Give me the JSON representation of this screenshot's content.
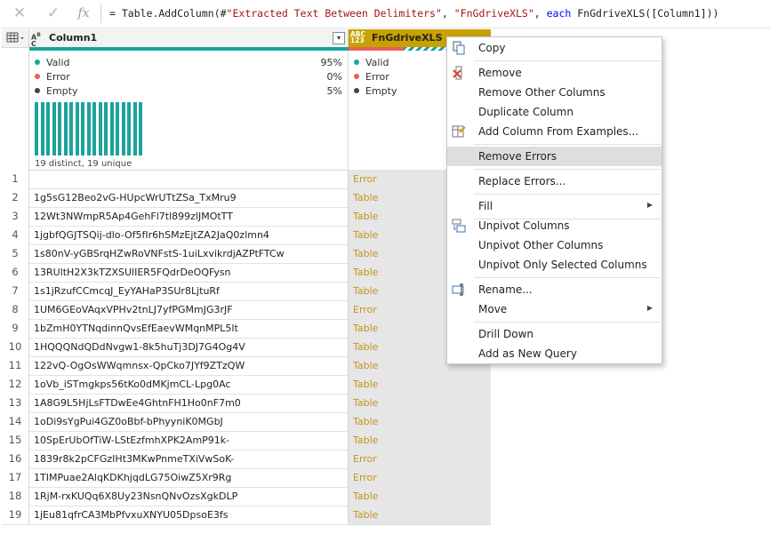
{
  "formula_bar": {
    "cancel_icon": "close-icon",
    "confirm_icon": "check-icon",
    "fx_label": "fx",
    "prefix": "= Table.AddColumn(#",
    "str1": "\"Extracted Text Between Delimiters\"",
    "mid1": ", ",
    "str2": "\"FnGdriveXLS\"",
    "mid2": ", ",
    "kw": "each",
    "suffix": " FnGdriveXLS([Column1]))"
  },
  "columns": [
    {
      "type_label_top": "A",
      "type_label_bottom": "C",
      "type_label_b": "B",
      "name": "Column1",
      "quality": [
        {
          "label": "Valid",
          "pct": "95%",
          "color": "#1ba39c"
        },
        {
          "label": "Error",
          "pct": "0%",
          "color": "#e8605b"
        },
        {
          "label": "Empty",
          "pct": "5%",
          "color": "#444444"
        }
      ],
      "distinct_summary": "19 distinct, 19 unique",
      "histogram_bars": 19
    },
    {
      "type_label_top": "ABC",
      "type_label_bottom": "123",
      "name": "FnGdriveXLS",
      "quality": [
        {
          "label": "Valid",
          "color": "#1ba39c"
        },
        {
          "label": "Error",
          "color": "#e8605b"
        },
        {
          "label": "Empty",
          "color": "#444444"
        }
      ]
    }
  ],
  "rows": [
    {
      "n": "1",
      "c1": "",
      "c2": "Error"
    },
    {
      "n": "2",
      "c1": "1g5sG12Beo2vG-HUpcWrUTtZSa_TxMru9",
      "c2": "Table"
    },
    {
      "n": "3",
      "c1": "12Wt3NWmpR5Ap4GehFl7tl899zlJMOtTT",
      "c2": "Table"
    },
    {
      "n": "4",
      "c1": "1jgbfQGJTSQij-dlo-Of5fIr6hSMzEjtZA2JaQ0zlmn4",
      "c2": "Table"
    },
    {
      "n": "5",
      "c1": "1s80nV-yGBSrqHZwRoVNFstS-1uiLxvikrdjAZPtFTCw",
      "c2": "Table"
    },
    {
      "n": "6",
      "c1": "13RUltH2X3kTZXSUlIER5FQdrDeOQFysn",
      "c2": "Table"
    },
    {
      "n": "7",
      "c1": "1s1jRzufCCmcqJ_EyYAHaP3SUr8LjtuRf",
      "c2": "Table"
    },
    {
      "n": "8",
      "c1": "1UM6GEoVAqxVPHv2tnLJ7yfPGMmJG3rJF",
      "c2": "Error"
    },
    {
      "n": "9",
      "c1": "1bZmH0YTNqdinnQvsEfEaevWMqnMPL5lt",
      "c2": "Table"
    },
    {
      "n": "10",
      "c1": "1HQQQNdQDdNvgw1-8k5huTj3DJ7G4Og4V",
      "c2": "Table"
    },
    {
      "n": "11",
      "c1": "122vQ-OgOsWWqmnsx-QpCko7JYf9ZTzQW",
      "c2": "Table"
    },
    {
      "n": "12",
      "c1": "1oVb_iSTmgkps56tKo0dMKjmCL-Lpg0Ac",
      "c2": "Table"
    },
    {
      "n": "13",
      "c1": "1A8G9L5HjLsFTDwEe4GhtnFH1Ho0nF7m0",
      "c2": "Table"
    },
    {
      "n": "14",
      "c1": "1oDi9sYgPui4GZ0oBbf-bPhyyniK0MGbJ",
      "c2": "Table"
    },
    {
      "n": "15",
      "c1": "10SpErUbOfTiW-LStEzfmhXPK2AmP91k-",
      "c2": "Table"
    },
    {
      "n": "16",
      "c1": "1839r8k2pCFGzIHt3MKwPnmeTXiVwSoK-",
      "c2": "Error"
    },
    {
      "n": "17",
      "c1": "1TIMPuae2AlqKDKhjqdLG75OiwZ5Xr9Rg",
      "c2": "Error"
    },
    {
      "n": "18",
      "c1": "1RjM-rxKUQq6X8Uy23NsnQNvOzsXgkDLP",
      "c2": "Table"
    },
    {
      "n": "19",
      "c1": "1jEu81qfrCA3MbPfvxuXNYU05DpsoE3fs",
      "c2": "Table"
    }
  ],
  "context_menu": {
    "items": [
      {
        "label": "Copy",
        "icon": "copy-icon"
      },
      {
        "label": "Remove",
        "icon": "remove-column-icon"
      },
      {
        "label": "Remove Other Columns"
      },
      {
        "label": "Duplicate Column"
      },
      {
        "label": "Add Column From Examples...",
        "icon": "add-column-examples-icon"
      },
      {
        "label": "Remove Errors"
      },
      {
        "label": "Replace Errors..."
      },
      {
        "label": "Fill"
      },
      {
        "label": "Unpivot Columns",
        "icon": "unpivot-icon"
      },
      {
        "label": "Unpivot Other Columns"
      },
      {
        "label": "Unpivot Only Selected Columns"
      },
      {
        "label": "Rename...",
        "icon": "rename-icon"
      },
      {
        "label": "Move"
      },
      {
        "label": "Drill Down"
      },
      {
        "label": "Add as New Query"
      }
    ],
    "highlighted": "Remove Errors"
  },
  "colors": {
    "accent": "#1ba39c",
    "error": "#e8605b",
    "selected_header": "#c8a200",
    "cell_value": "#c2961d"
  }
}
